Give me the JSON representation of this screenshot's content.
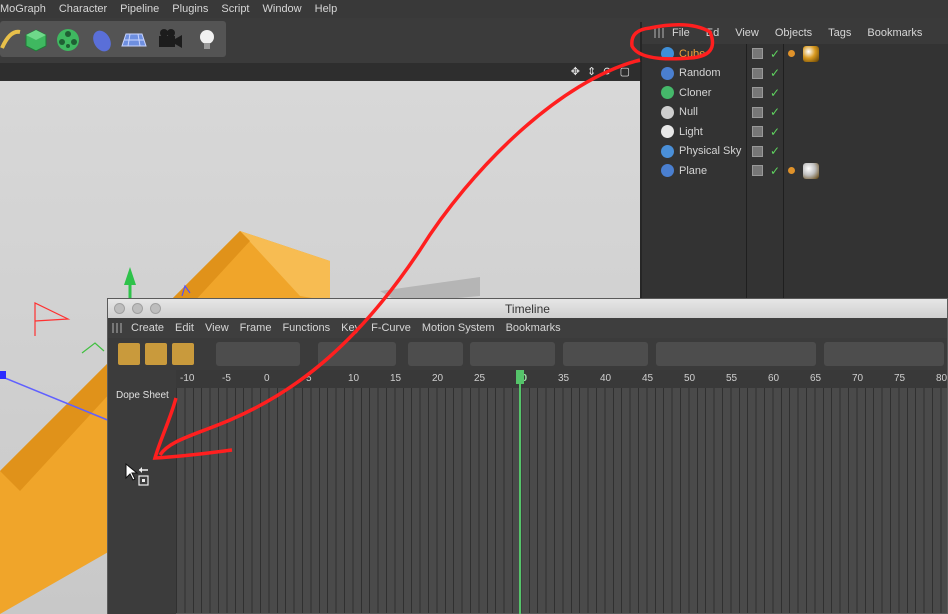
{
  "menubar": {
    "items": [
      "MoGraph",
      "Character",
      "Pipeline",
      "Plugins",
      "Script",
      "Window",
      "Help"
    ]
  },
  "toolbar": {
    "tools": [
      "bend-icon",
      "cube-object-icon",
      "cloner-icon",
      "deformer-icon",
      "floor-icon",
      "camera-icon",
      "light-icon"
    ]
  },
  "object_manager": {
    "menu": [
      "File",
      "Ed",
      "View",
      "Objects",
      "Tags",
      "Bookmarks"
    ],
    "objects": [
      {
        "name": "Cube",
        "selected": true,
        "icon_color": "#3f8fd8",
        "has_material": true,
        "material_color": "#d99a20"
      },
      {
        "name": "Random",
        "selected": false,
        "icon_color": "#4a7fd0",
        "has_material": false
      },
      {
        "name": "Cloner",
        "selected": false,
        "icon_color": "#45b86a",
        "has_material": false
      },
      {
        "name": "Null",
        "selected": false,
        "icon_color": "#cfcfcf",
        "has_material": false
      },
      {
        "name": "Light",
        "selected": false,
        "icon_color": "#e8e8e8",
        "has_material": false
      },
      {
        "name": "Physical Sky",
        "selected": false,
        "icon_color": "#4a8fd8",
        "has_material": false
      },
      {
        "name": "Plane",
        "selected": false,
        "icon_color": "#4a7fd0",
        "has_material": true,
        "material_color": "#bfbfbf"
      }
    ]
  },
  "timeline": {
    "title": "Timeline",
    "menu": [
      "Create",
      "Edit",
      "View",
      "Frame",
      "Functions",
      "Key",
      "F-Curve",
      "Motion System",
      "Bookmarks"
    ],
    "mode_label": "Dope Sheet",
    "ruler_ticks": [
      "-10",
      "-5",
      "0",
      "5",
      "10",
      "15",
      "20",
      "25",
      "30",
      "35",
      "40",
      "45",
      "50",
      "55",
      "60",
      "65",
      "70",
      "75",
      "80"
    ],
    "current_frame": "30"
  },
  "colors": {
    "annotation": "#ff1f1f",
    "selected_text": "#f2a23a",
    "playhead": "#55c46a",
    "cube": "#f0a52a"
  }
}
